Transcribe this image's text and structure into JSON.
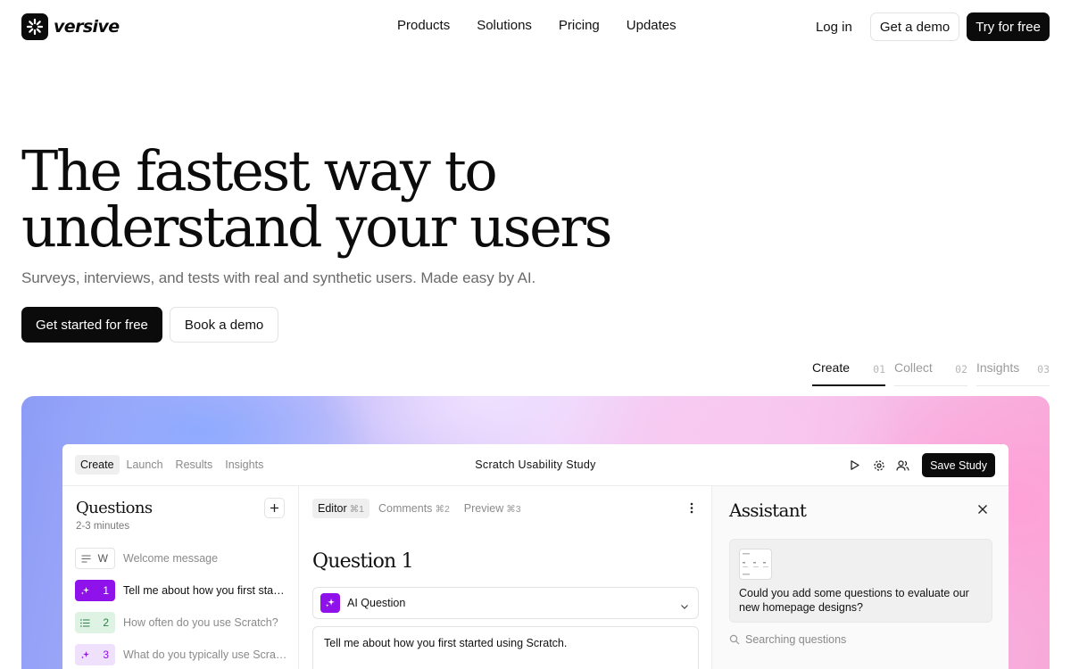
{
  "brand": {
    "name": "versive"
  },
  "nav": {
    "links": [
      "Products",
      "Solutions",
      "Pricing",
      "Updates"
    ],
    "login": "Log in",
    "demo": "Get a demo",
    "trial": "Try for free"
  },
  "hero": {
    "title_line1": "The fastest way to",
    "title_line2": "understand your users",
    "subtitle": "Surveys, interviews, and tests with real and synthetic users. Made easy by AI.",
    "cta_primary": "Get started for free",
    "cta_secondary": "Book a demo"
  },
  "steps": [
    {
      "label": "Create",
      "num": "01"
    },
    {
      "label": "Collect",
      "num": "02"
    },
    {
      "label": "Insights",
      "num": "03"
    }
  ],
  "app": {
    "tabs": [
      "Create",
      "Launch",
      "Results",
      "Insights"
    ],
    "study_title": "Scratch Usability Study",
    "save": "Save Study",
    "questions": {
      "heading": "Questions",
      "duration": "2-3 minutes",
      "items": [
        {
          "badge": "W",
          "text": "Welcome message"
        },
        {
          "badge": "1",
          "text": "Tell me about how you first started using Scratch."
        },
        {
          "badge": "2",
          "text": "How often do you use Scratch?"
        },
        {
          "badge": "3",
          "text": "What do you typically use Scratch for?"
        }
      ]
    },
    "editor": {
      "tabs": [
        {
          "label": "Editor",
          "kbd": "⌘1"
        },
        {
          "label": "Comments",
          "kbd": "⌘2"
        },
        {
          "label": "Preview",
          "kbd": "⌘3"
        }
      ],
      "question_title": "Question 1",
      "type": "AI Question",
      "prompt": "Tell me about how you first started using Scratch."
    },
    "assistant": {
      "heading": "Assistant",
      "message": "Could you add some questions to evaluate our new homepage designs?",
      "status": "Searching questions"
    }
  },
  "colors": {
    "accent_purple": "#8f12ea",
    "dark": "#0b0b0b",
    "green_soft": "#dff3e5"
  }
}
